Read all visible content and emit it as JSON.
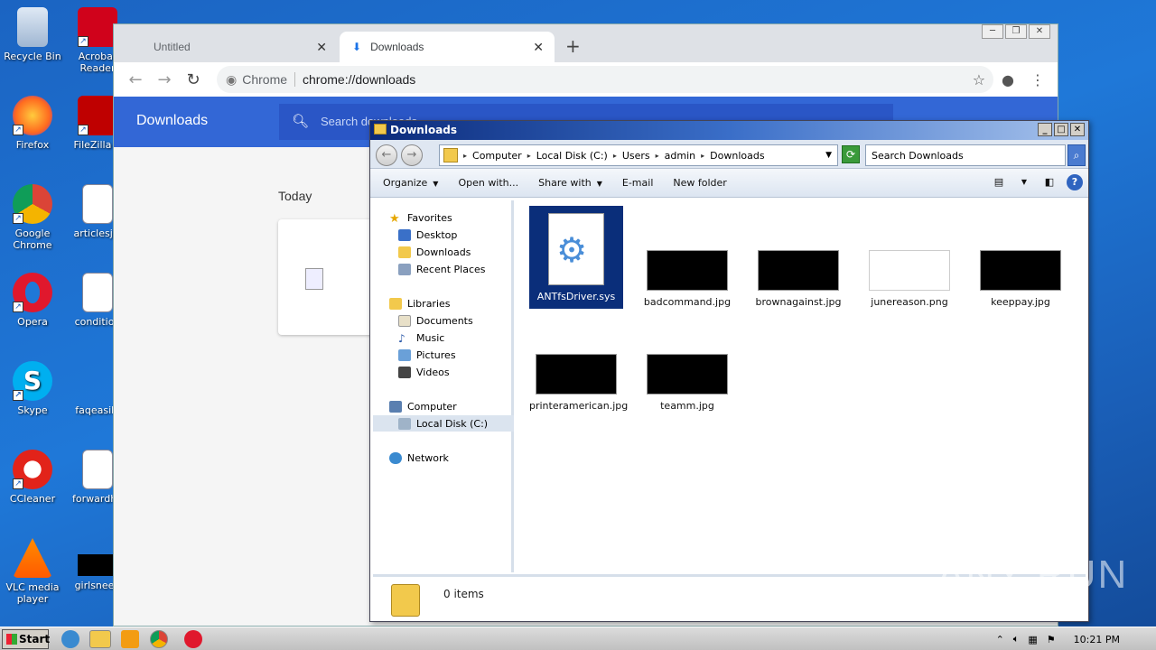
{
  "desktop": {
    "icons": [
      {
        "label": "Recycle Bin"
      },
      {
        "label": "Acrobat Reader"
      },
      {
        "label": "Firefox"
      },
      {
        "label": "FileZilla C"
      },
      {
        "label": "Google Chrome"
      },
      {
        "label": "articlesjoi"
      },
      {
        "label": "Opera"
      },
      {
        "label": "condition"
      },
      {
        "label": "Skype"
      },
      {
        "label": "faqeasily"
      },
      {
        "label": "CCleaner"
      },
      {
        "label": "forwardhe"
      },
      {
        "label": "VLC media player"
      },
      {
        "label": "girlsneed"
      }
    ]
  },
  "chrome": {
    "tabs": [
      {
        "label": "Untitled"
      },
      {
        "label": "Downloads"
      }
    ],
    "omnibox": {
      "chip": "Chrome",
      "url": "chrome://downloads"
    },
    "downloads": {
      "title": "Downloads",
      "search_placeholder": "Search downloads",
      "section": "Today"
    }
  },
  "explorer": {
    "title": "Downloads",
    "breadcrumb": [
      "Computer",
      "Local Disk (C:)",
      "Users",
      "admin",
      "Downloads"
    ],
    "search_placeholder": "Search Downloads",
    "commands": [
      "Organize",
      "Open with...",
      "Share with",
      "E-mail",
      "New folder"
    ],
    "nav": {
      "favorites": "Favorites",
      "desktop": "Desktop",
      "downloads": "Downloads",
      "recent": "Recent Places",
      "libraries": "Libraries",
      "documents": "Documents",
      "music": "Music",
      "pictures": "Pictures",
      "videos": "Videos",
      "computer": "Computer",
      "localdisk": "Local Disk (C:)",
      "network": "Network"
    },
    "files": [
      {
        "name": "ANTfsDriver.sys"
      },
      {
        "name": "badcommand.jpg"
      },
      {
        "name": "brownagainst.jpg"
      },
      {
        "name": "junereason.png"
      },
      {
        "name": "keeppay.jpg"
      },
      {
        "name": "printeramerican.jpg"
      },
      {
        "name": "teamm.jpg"
      }
    ],
    "status": "0 items"
  },
  "watermark": "ANY RUN",
  "taskbar": {
    "start": "Start",
    "clock": "10:21 PM"
  },
  "colors": {
    "desktop_bg": "#1f78d8",
    "chrome_blue": "#3367d6",
    "selection": "#0a2e7a"
  }
}
